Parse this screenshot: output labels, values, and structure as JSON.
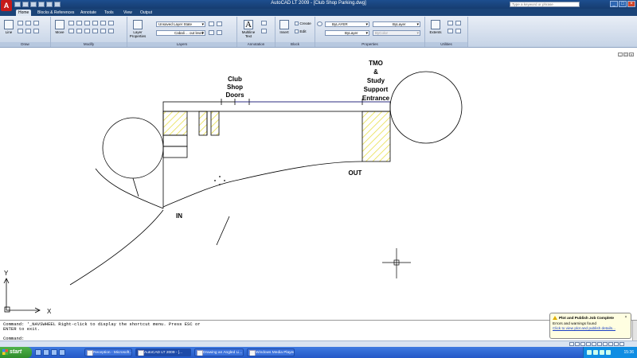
{
  "app": {
    "logo_letter": "A",
    "title": "AutoCAD LT 2009 - [Club Shop Parking.dwg]",
    "search_placeholder": "Type a keyword or phrase"
  },
  "tabs": [
    "Home",
    "Blocks & References",
    "Annotate",
    "Tools",
    "View",
    "Output"
  ],
  "ribbon": {
    "draw": {
      "label": "Draw",
      "line": "Line"
    },
    "modify": {
      "label": "Modify",
      "move": "Move"
    },
    "layers": {
      "label": "Layers",
      "layer_properties": "Layer Properties",
      "layer_state": "Unsaved Layer State",
      "current_layer": "Cabali ... out level"
    },
    "annotation": {
      "label": "Annotation",
      "multiline_text": "Multiline Text"
    },
    "block": {
      "label": "Block",
      "insert": "Insert",
      "create": "Create",
      "edit": "Edit"
    },
    "properties": {
      "label": "Properties",
      "color": "ByLAYER",
      "linetype": "ByLayer",
      "lineweight": "ByLayer",
      "plotstyle": "ByColor"
    },
    "utilities": {
      "label": "Utilities",
      "extents": "Extents"
    }
  },
  "drawing": {
    "labels": {
      "club_shop_doors": [
        "Club",
        "Shop",
        "Doors"
      ],
      "tmo": [
        "TMO",
        "&",
        "Study",
        "Support",
        "Entrance"
      ],
      "out": "OUT",
      "in": "IN"
    },
    "ucs": {
      "x": "X",
      "y": "Y"
    },
    "colors": {
      "hatch": "#e6dc3a",
      "line": "#000000",
      "accent_line": "#2b2bd0"
    }
  },
  "command": {
    "history": "Command: '_NAVSWHEEL Right-click to display the shortcut menu. Press ESC or ENTER to exit.",
    "prompt": "Command:"
  },
  "notification": {
    "title": "Plot and Publish Job Complete",
    "line1": "Errors and warnings found",
    "link": "Click to view plot and publish details..."
  },
  "taskbar": {
    "start": "start",
    "tasks": [
      "Reception - Microsoft...",
      "AutoCAD LT 2009 - [...",
      "Drawing an Angled Li...",
      "Windows Media Player"
    ],
    "clock": "15:36"
  }
}
